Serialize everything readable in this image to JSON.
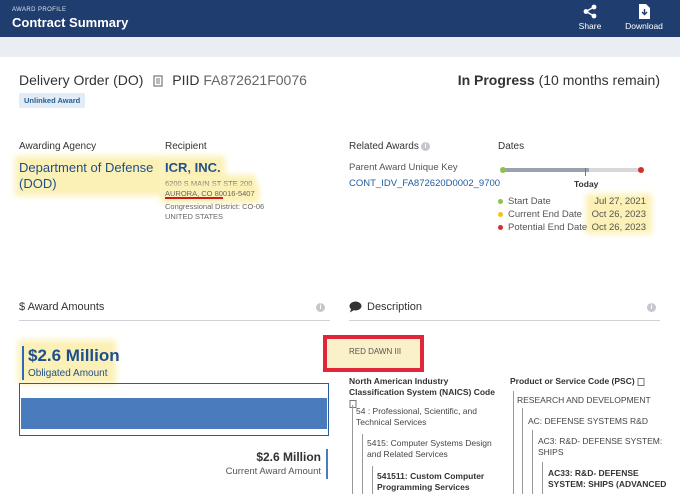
{
  "header": {
    "eyebrow": "AWARD PROFILE",
    "title": "Contract Summary",
    "share_label": "Share",
    "download_label": "Download",
    "bg_color": "#1f3d6e"
  },
  "award": {
    "type_title": "Delivery Order (DO)",
    "piid_label": "PIID",
    "piid": "FA872621F0076",
    "badge": "Unlinked Award",
    "status_bold": "In Progress",
    "status_detail": "(10 months remain)"
  },
  "agency": {
    "label": "Awarding Agency",
    "name": "Department of Defense (DOD)"
  },
  "recipient": {
    "label": "Recipient",
    "name": "ICR, INC.",
    "address1": "6200 S MAIN ST STE 200",
    "address2": "AURORA, CO 80016-5407",
    "district": "Congressional District: CO-06",
    "country": "UNITED STATES"
  },
  "related": {
    "label": "Related Awards",
    "parent_label": "Parent Award Unique Key",
    "parent_link": "CONT_IDV_FA872620D0002_9700"
  },
  "dates": {
    "label": "Dates",
    "today_label": "Today",
    "progress_fraction": 0.62,
    "rows": [
      {
        "label": "Start Date",
        "value": "Jul 27, 2021",
        "color": "#8bc34a"
      },
      {
        "label": "Current End Date",
        "value": "Oct 26, 2023",
        "color": "#f0c419"
      },
      {
        "label": "Potential End Date",
        "value": "Oct 26, 2023",
        "color": "#d32f2f"
      }
    ]
  },
  "amounts": {
    "label": "$ Award Amounts",
    "obligated_value": "$2.6 Million",
    "obligated_label": "Obligated Amount",
    "obligated_fraction": 1.0,
    "current_value": "$2.6 Million",
    "current_label": "Current Award Amount"
  },
  "description": {
    "label": "Description",
    "text": "RED DAWN III",
    "naics_title": "North American Industry Classification System (NAICS) Code",
    "naics_items": [
      "54 : Professional, Scientific, and Technical Services",
      "5415: Computer Systems Design and Related Services",
      "541511: Custom Computer Programming Services"
    ],
    "psc_title": "Product or Service Code (PSC)",
    "psc_items": [
      "RESEARCH AND DEVELOPMENT",
      "AC: DEFENSE SYSTEMS R&D",
      "AC3: R&D- DEFENSE SYSTEM: SHIPS",
      "AC33: R&D- DEFENSE SYSTEM: SHIPS (ADVANCED"
    ]
  }
}
